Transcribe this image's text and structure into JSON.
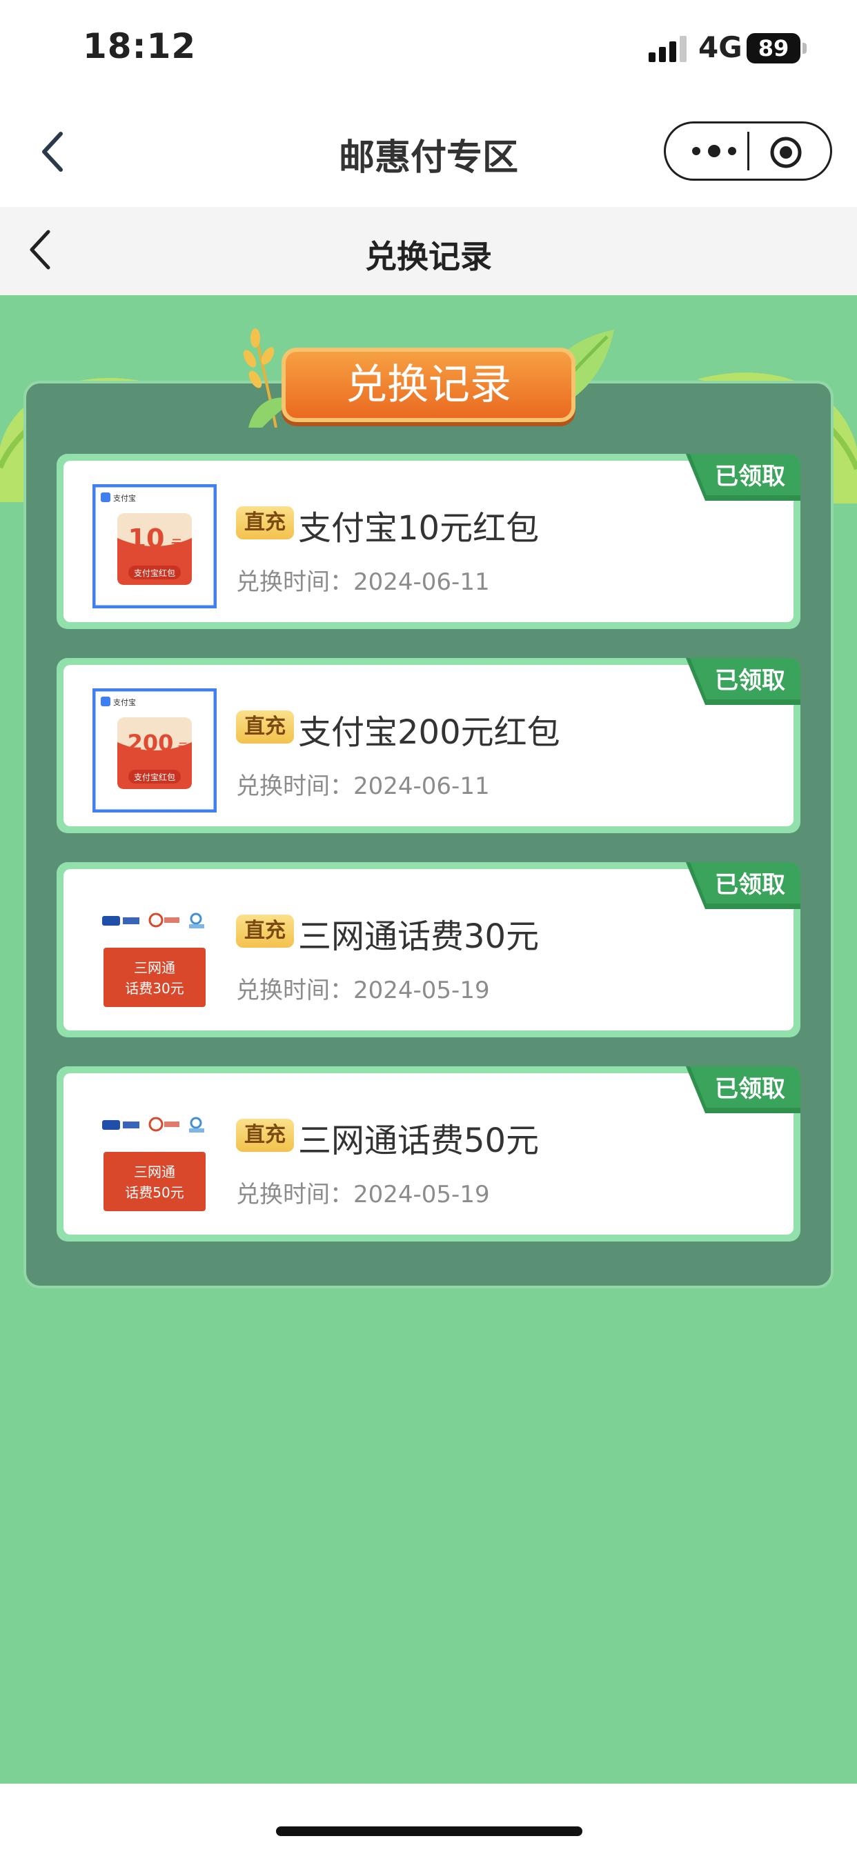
{
  "status_bar": {
    "time": "18:12",
    "network": "4G",
    "battery": "89"
  },
  "nav_bar": {
    "title": "邮惠付专区"
  },
  "page_header": {
    "title": "兑换记录"
  },
  "panel": {
    "banner_title": "兑换记录"
  },
  "records": [
    {
      "tag": "直充",
      "title": "支付宝10元红包",
      "time": "兑换时间：2024-06-11",
      "status": "已领取",
      "thumb": {
        "type": "alipay",
        "brand": "支付宝",
        "amount": "10",
        "unit": "元",
        "caption": "支付宝红包"
      }
    },
    {
      "tag": "直充",
      "title": "支付宝200元红包",
      "time": "兑换时间：2024-06-11",
      "status": "已领取",
      "thumb": {
        "type": "alipay",
        "brand": "支付宝",
        "amount": "200",
        "unit": "元",
        "caption": "支付宝红包"
      }
    },
    {
      "tag": "直充",
      "title": "三网通话费30元",
      "time": "兑换时间：2024-05-19",
      "status": "已领取",
      "thumb": {
        "type": "telecom",
        "line1": "三网通",
        "line2": "话费30元"
      }
    },
    {
      "tag": "直充",
      "title": "三网通话费50元",
      "time": "兑换时间：2024-05-19",
      "status": "已领取",
      "thumb": {
        "type": "telecom",
        "line1": "三网通",
        "line2": "话费50元"
      }
    }
  ],
  "colors": {
    "page_green": "#7dd194",
    "panel_green": "#5a9175",
    "card_border": "#92e1ad",
    "ribbon_green": "#3aa45c",
    "banner_orange": "#ea6a20",
    "alipay_blue": "#3f7ff0",
    "telecom_red": "#d9482b"
  },
  "icons": {
    "nav_back": "chevron-left-icon",
    "capsule_more": "more-dots-icon",
    "capsule_close": "close-circle-icon",
    "page_back": "chevron-left-icon",
    "signal": "cellular-signal-icon"
  }
}
